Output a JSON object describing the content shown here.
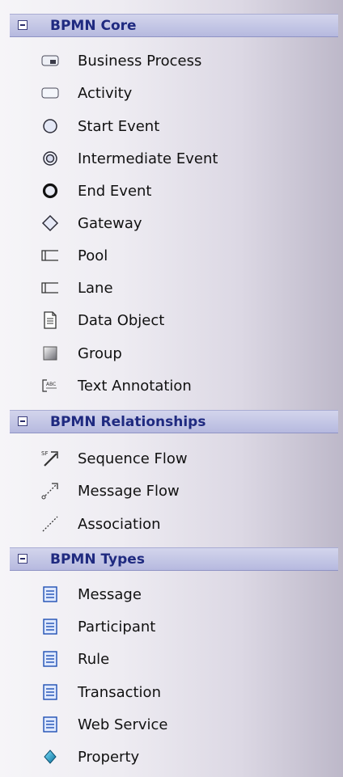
{
  "sections": [
    {
      "title": "BPMN Core",
      "items": [
        {
          "label": "Business Process",
          "icon": "business-process-icon"
        },
        {
          "label": "Activity",
          "icon": "activity-icon"
        },
        {
          "label": "Start Event",
          "icon": "start-event-icon"
        },
        {
          "label": "Intermediate Event",
          "icon": "intermediate-event-icon"
        },
        {
          "label": "End Event",
          "icon": "end-event-icon"
        },
        {
          "label": "Gateway",
          "icon": "gateway-icon"
        },
        {
          "label": "Pool",
          "icon": "pool-icon"
        },
        {
          "label": "Lane",
          "icon": "lane-icon"
        },
        {
          "label": "Data Object",
          "icon": "data-object-icon"
        },
        {
          "label": "Group",
          "icon": "group-icon"
        },
        {
          "label": "Text Annotation",
          "icon": "text-annotation-icon"
        }
      ]
    },
    {
      "title": "BPMN Relationships",
      "items": [
        {
          "label": "Sequence Flow",
          "icon": "sequence-flow-icon"
        },
        {
          "label": "Message Flow",
          "icon": "message-flow-icon"
        },
        {
          "label": "Association",
          "icon": "association-icon"
        }
      ]
    },
    {
      "title": "BPMN Types",
      "items": [
        {
          "label": "Message",
          "icon": "message-type-icon"
        },
        {
          "label": "Participant",
          "icon": "participant-type-icon"
        },
        {
          "label": "Rule",
          "icon": "rule-type-icon"
        },
        {
          "label": "Transaction",
          "icon": "transaction-type-icon"
        },
        {
          "label": "Web Service",
          "icon": "web-service-type-icon"
        },
        {
          "label": "Property",
          "icon": "property-icon"
        }
      ]
    }
  ],
  "icon_text": {
    "sequence_flow": "SF",
    "text_annotation": "ABC"
  }
}
